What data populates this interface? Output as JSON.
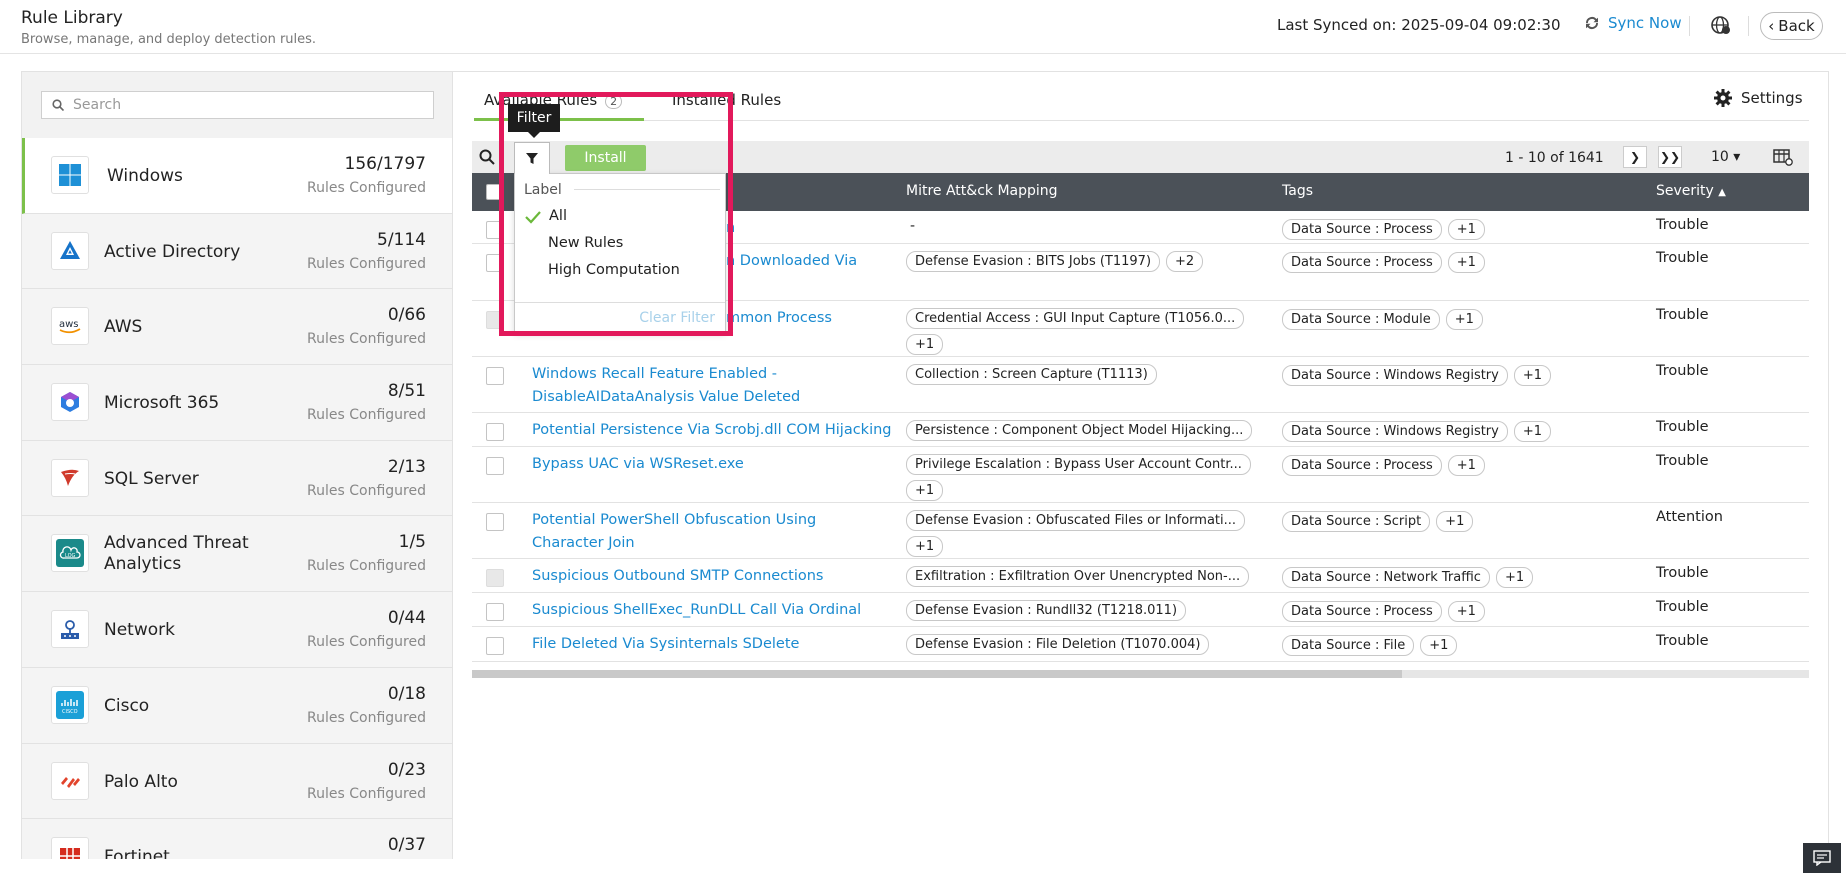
{
  "header": {
    "title": "Rule Library",
    "subtitle": "Browse, manage, and deploy detection rules.",
    "last_synced": "Last Synced on: 2025-09-04 09:02:30",
    "sync_now": "Sync Now",
    "back": "Back"
  },
  "sidebar": {
    "search_placeholder": "Search",
    "items": [
      {
        "name": "Windows",
        "count": "156/1797",
        "sub": "Rules Configured",
        "icon": "windows-icon"
      },
      {
        "name": "Active Directory",
        "count": "5/114",
        "sub": "Rules Configured",
        "icon": "active-directory-icon"
      },
      {
        "name": "AWS",
        "count": "0/66",
        "sub": "Rules Configured",
        "icon": "aws-icon"
      },
      {
        "name": "Microsoft 365",
        "count": "8/51",
        "sub": "Rules Configured",
        "icon": "microsoft-365-icon"
      },
      {
        "name": "SQL Server",
        "count": "2/13",
        "sub": "Rules Configured",
        "icon": "sql-server-icon"
      },
      {
        "name": "Advanced Threat Analytics",
        "count": "1/5",
        "sub": "Rules Configured",
        "icon": "ata-icon"
      },
      {
        "name": "Network",
        "count": "0/44",
        "sub": "Rules Configured",
        "icon": "network-icon"
      },
      {
        "name": "Cisco",
        "count": "0/18",
        "sub": "Rules Configured",
        "icon": "cisco-icon"
      },
      {
        "name": "Palo Alto",
        "count": "0/23",
        "sub": "Rules Configured",
        "icon": "palo-alto-icon"
      },
      {
        "name": "Fortinet",
        "count": "0/37",
        "sub": "",
        "icon": "fortinet-icon"
      }
    ]
  },
  "tabs": {
    "available": "Available Rules",
    "available_badge": "2",
    "installed": "Installed Rules",
    "settings": "Settings"
  },
  "toolbar": {
    "install": "Install",
    "pager": "1 - 10 of 1641",
    "per_page": "10"
  },
  "filter": {
    "tooltip": "Filter",
    "label": "Label",
    "options": [
      "All",
      "New Rules",
      "High Computation"
    ],
    "selected": "All",
    "clear": "Clear Filter"
  },
  "table": {
    "columns": [
      "Mitre Att&ck Mapping",
      "Tags",
      "Severity"
    ],
    "rows": [
      {
        "name": "n",
        "mitre": [
          "-"
        ],
        "tags": [
          "Data Source : Process",
          "+1"
        ],
        "severity": "Trouble"
      },
      {
        "name": "n Downloaded Via",
        "mitre": [
          "Defense Evasion : BITS Jobs (T1197)",
          "+2"
        ],
        "tags": [
          "Data Source : Process",
          "+1"
        ],
        "severity": "Trouble"
      },
      {
        "name": "mmon Process",
        "mitre": [
          "Credential Access : GUI Input Capture (T1056.0...",
          "+1"
        ],
        "tags": [
          "Data Source : Module",
          "+1"
        ],
        "severity": "Trouble"
      },
      {
        "name": "Windows Recall Feature Enabled - DisableAIDataAnalysis Value Deleted",
        "mitre": [
          "Collection : Screen Capture (T1113)"
        ],
        "tags": [
          "Data Source : Windows Registry",
          "+1"
        ],
        "severity": "Trouble"
      },
      {
        "name": "Potential Persistence Via Scrobj.dll COM Hijacking",
        "mitre": [
          "Persistence : Component Object Model Hijacking..."
        ],
        "tags": [
          "Data Source : Windows Registry",
          "+1"
        ],
        "severity": "Trouble"
      },
      {
        "name": "Bypass UAC via WSReset.exe",
        "mitre": [
          "Privilege Escalation : Bypass User Account Contr...",
          "+1"
        ],
        "tags": [
          "Data Source : Process",
          "+1"
        ],
        "severity": "Trouble"
      },
      {
        "name": "Potential PowerShell Obfuscation Using Character Join",
        "mitre": [
          "Defense Evasion : Obfuscated Files or Informati...",
          "+1"
        ],
        "tags": [
          "Data Source : Script",
          "+1"
        ],
        "severity": "Attention"
      },
      {
        "name": "Suspicious Outbound SMTP Connections",
        "mitre": [
          "Exfiltration : Exfiltration Over Unencrypted Non-..."
        ],
        "tags": [
          "Data Source : Network Traffic",
          "+1"
        ],
        "severity": "Trouble"
      },
      {
        "name": "Suspicious ShellExec_RunDLL Call Via Ordinal",
        "mitre": [
          "Defense Evasion : Rundll32 (T1218.011)"
        ],
        "tags": [
          "Data Source : Process",
          "+1"
        ],
        "severity": "Trouble"
      },
      {
        "name": "File Deleted Via Sysinternals SDelete",
        "mitre": [
          "Defense Evasion : File Deletion (T1070.004)"
        ],
        "tags": [
          "Data Source : File",
          "+1"
        ],
        "severity": "Trouble"
      }
    ]
  },
  "colors": {
    "accent_green": "#7cc04a",
    "link_blue": "#1a8ad0",
    "highlight": "#e2195b",
    "table_header": "#4b5158"
  }
}
